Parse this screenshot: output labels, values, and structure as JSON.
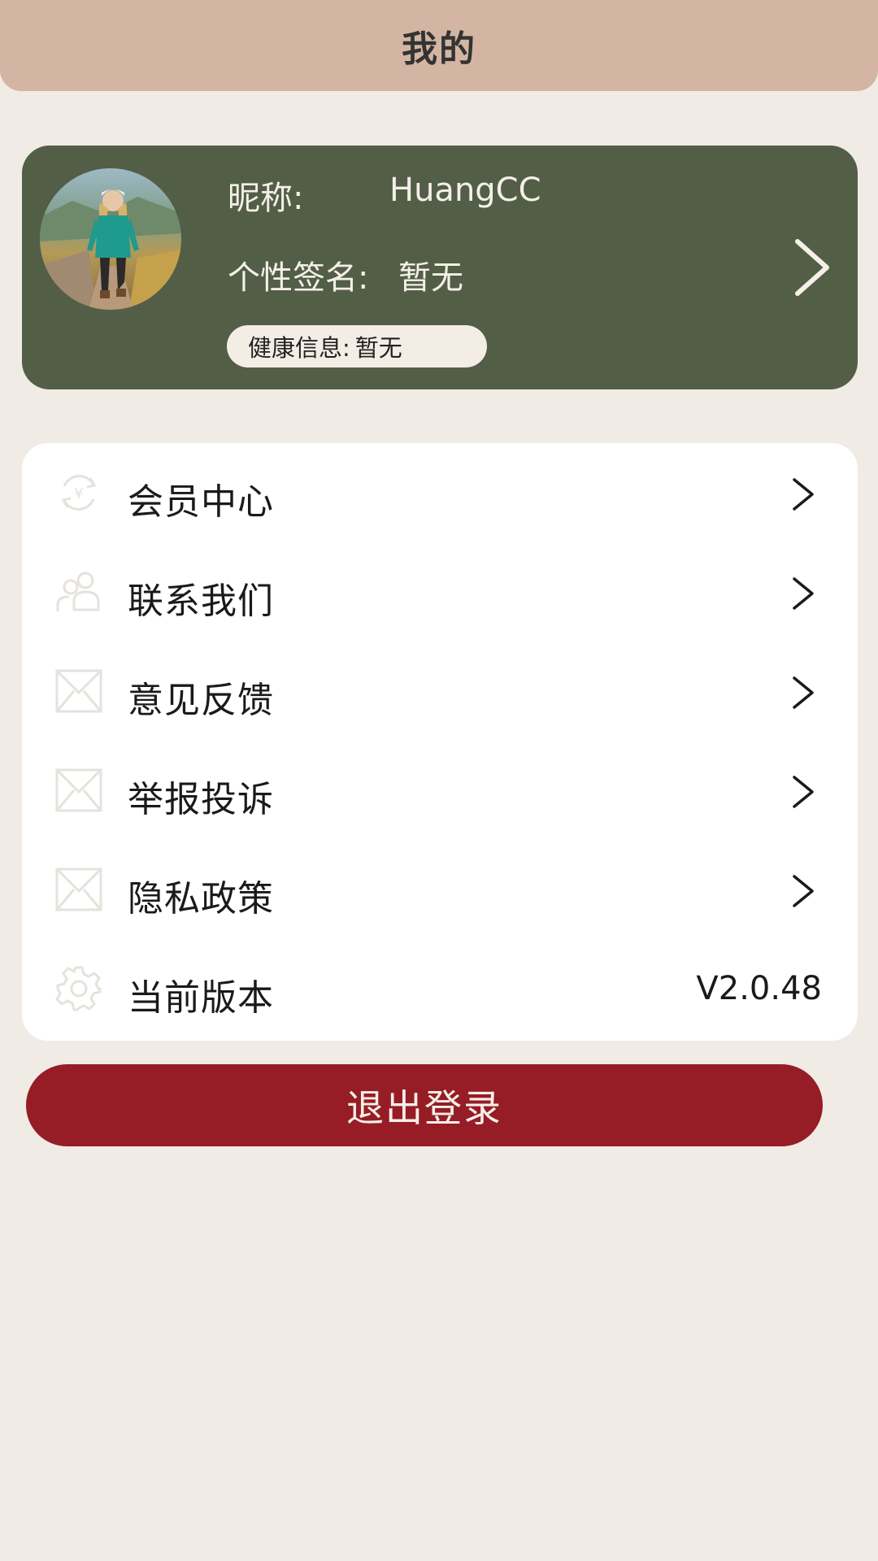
{
  "header": {
    "title": "我的"
  },
  "profile": {
    "nickname_label": "昵称:",
    "nickname": "HuangCC",
    "signature_label": "个性签名:",
    "signature": "暂无",
    "health_label": "健康信息:",
    "health_value": "暂无",
    "avatar_icon": "avatar-photo",
    "arrow_icon": "chevron-right-icon"
  },
  "menu": {
    "items": [
      {
        "label": "会员中心",
        "icon": "yuan-refresh-icon"
      },
      {
        "label": "联系我们",
        "icon": "contacts-icon"
      },
      {
        "label": "意见反馈",
        "icon": "envelope-icon"
      },
      {
        "label": "举报投诉",
        "icon": "envelope-icon"
      },
      {
        "label": "隐私政策",
        "icon": "envelope-icon"
      },
      {
        "label": "当前版本",
        "icon": "gear-icon",
        "value": "V2.0.48"
      }
    ]
  },
  "logout": {
    "label": "退出登录"
  },
  "colors": {
    "background": "#f1ebe5",
    "header": "#d4b5a3",
    "profile_card": "#535e47",
    "logout_button": "#961d25"
  }
}
